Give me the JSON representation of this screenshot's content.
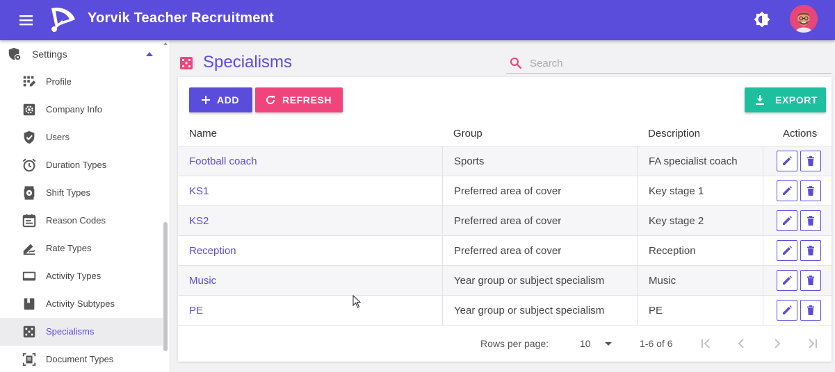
{
  "app": {
    "title": "Yorvik Teacher Recruitment"
  },
  "icons": {
    "menu": "menu-icon",
    "logo": "logo-icon",
    "theme": "brightness-icon",
    "avatar": "user-avatar"
  },
  "colors": {
    "primary": "#5b4ddb",
    "accent": "#f0457c",
    "export": "#1dbf9f"
  },
  "sidebar": {
    "section": {
      "label": "Settings",
      "icon": "settings-shield-icon",
      "expanded": true
    },
    "items": [
      {
        "label": "Profile",
        "icon": "profile-icon"
      },
      {
        "label": "Company Info",
        "icon": "gear-icon"
      },
      {
        "label": "Users",
        "icon": "shield-check-icon"
      },
      {
        "label": "Duration Types",
        "icon": "alarm-clock-icon"
      },
      {
        "label": "Shift Types",
        "icon": "shift-timer-icon"
      },
      {
        "label": "Reason Codes",
        "icon": "calendar-icon"
      },
      {
        "label": "Rate Types",
        "icon": "signature-icon"
      },
      {
        "label": "Activity Types",
        "icon": "screen-icon"
      },
      {
        "label": "Activity Subtypes",
        "icon": "bookmark-icon"
      },
      {
        "label": "Specialisms",
        "icon": "dice-icon",
        "active": true
      },
      {
        "label": "Document Types",
        "icon": "document-icon"
      }
    ]
  },
  "page": {
    "title": "Specialisms",
    "icon": "dice-icon"
  },
  "search": {
    "placeholder": "Search",
    "value": ""
  },
  "toolbar": {
    "add_label": "ADD",
    "refresh_label": "REFRESH",
    "export_label": "EXPORT"
  },
  "table": {
    "headers": {
      "name": "Name",
      "group": "Group",
      "description": "Description",
      "actions": "Actions"
    },
    "rows": [
      {
        "name": "Football coach",
        "group": "Sports",
        "description": "FA specialist coach"
      },
      {
        "name": "KS1",
        "group": "Preferred area of cover",
        "description": "Key stage 1"
      },
      {
        "name": "KS2",
        "group": "Preferred area of cover",
        "description": "Key stage 2"
      },
      {
        "name": "Reception",
        "group": "Preferred area of cover",
        "description": "Reception"
      },
      {
        "name": "Music",
        "group": "Year group or subject specialism",
        "description": "Music"
      },
      {
        "name": "PE",
        "group": "Year group or subject specialism",
        "description": "PE"
      }
    ]
  },
  "pagination": {
    "rows_per_page_label": "Rows per page:",
    "rows_per_page": "10",
    "range": "1-6 of 6"
  }
}
